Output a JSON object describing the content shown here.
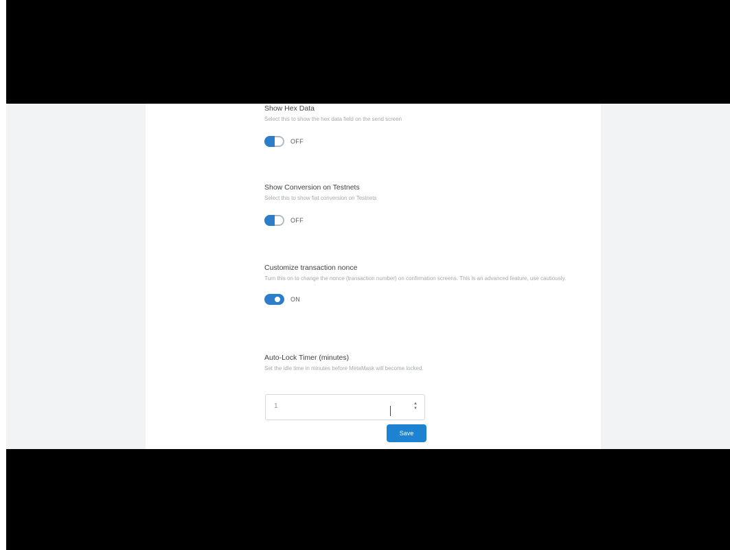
{
  "colors": {
    "accent": "#2c7ecb",
    "button": "#1e82d2",
    "title": "#3b3f44",
    "description": "#a4a9ad"
  },
  "settings": [
    {
      "title": "Show Hex Data",
      "description": "Select this to show the hex data field on the send screen",
      "toggle": {
        "state": "off",
        "label": "OFF"
      }
    },
    {
      "title": "Show Conversion on Testnets",
      "description": "Select this to show fiat conversion on Testnets",
      "toggle": {
        "state": "off",
        "label": "OFF"
      }
    },
    {
      "title": "Customize transaction nonce",
      "description": "Turn this on to change the nonce (transaction number) on confirmation screens. This is an advanced feature, use cautiously.",
      "toggle": {
        "state": "on",
        "label": "ON"
      }
    },
    {
      "title": "Auto-Lock Timer (minutes)",
      "description": "Set the idle time in minutes before MetaMask will become locked."
    }
  ],
  "auto_lock": {
    "value": "1",
    "spinner_icons": [
      "chevron-up-icon",
      "chevron-down-icon"
    ],
    "save_label": "Save"
  }
}
